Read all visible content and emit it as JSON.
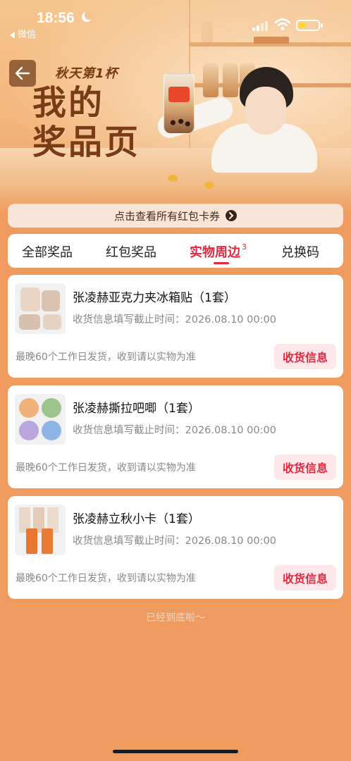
{
  "status_bar": {
    "time": "18:56",
    "back_app": "微信"
  },
  "hero": {
    "subtitle": "秋天第1杯",
    "title_line1": "我的",
    "title_line2": "奖品页"
  },
  "voucher_link": {
    "label": "点击查看所有红包卡券"
  },
  "tabs": [
    {
      "label": "全部奖品"
    },
    {
      "label": "红包奖品"
    },
    {
      "label": "实物周边",
      "count": "3",
      "active": true
    },
    {
      "label": "兑换码"
    }
  ],
  "items": [
    {
      "name": "张凌赫亚克力夹冰箱贴（1套）",
      "deadline": "收货信息填写截止时间：2026.08.10 00:00",
      "ship_note": "最晚60个工作日发货，收到请以实物为准",
      "button": "收货信息"
    },
    {
      "name": "张凌赫撕拉吧唧（1套）",
      "deadline": "收货信息填写截止时间：2026.08.10 00:00",
      "ship_note": "最晚60个工作日发货，收到请以实物为准",
      "button": "收货信息"
    },
    {
      "name": "张凌赫立秋小卡（1套）",
      "deadline": "收货信息填写截止时间：2026.08.10 00:00",
      "ship_note": "最晚60个工作日发货，收到请以实物为准",
      "button": "收货信息"
    }
  ],
  "footer": {
    "end_text": "已经到底啦～"
  },
  "colors": {
    "accent": "#e3273f",
    "page_bg": "#ef9a5e",
    "button_bg": "#fde7ea"
  }
}
